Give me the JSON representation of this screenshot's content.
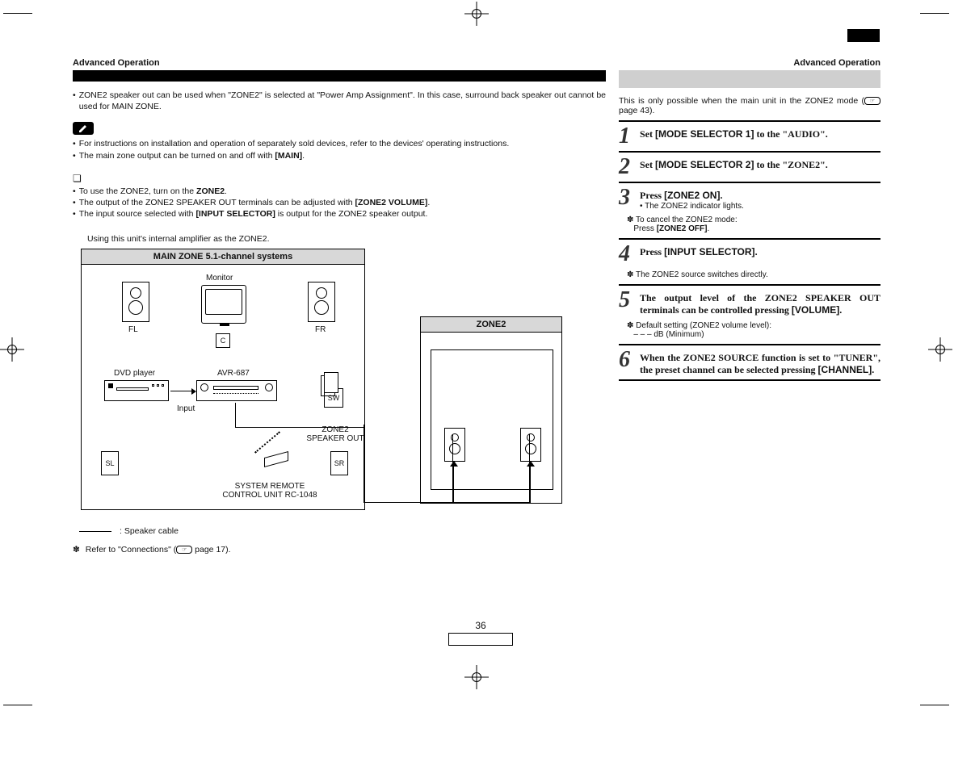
{
  "header_left": "Advanced Operation",
  "header_right": "Advanced Operation",
  "intro1": "ZONE2 speaker out can be used when \"ZONE2\" is selected at \"Power Amp Assignment\". In this case, surround back speaker out cannot be used for MAIN ZONE.",
  "note1": "For instructions on installation and operation of separately sold devices, refer to the devices' operating instructions.",
  "note2_a": "The main zone output can be turned on and off with ",
  "note2_b": "[MAIN]",
  "note2_c": ".",
  "zone2_b1_a": "To use the ZONE2, turn on the ",
  "zone2_b1_b": "ZONE2",
  "zone2_b1_c": ".",
  "zone2_b2_a": "The output of the ZONE2 SPEAKER OUT terminals can be adjusted with ",
  "zone2_b2_b": "[ZONE2 VOLUME]",
  "zone2_b2_c": ".",
  "zone2_b3_a": "The input source selected with ",
  "zone2_b3_b": "[INPUT SELECTOR]",
  "zone2_b3_c": " is output for the ZONE2 speaker output.",
  "caption": "Using this unit's internal amplifier as the ZONE2.",
  "diagram": {
    "mainzone_title": "MAIN ZONE 5.1-channel systems",
    "monitor": "Monitor",
    "fl": "FL",
    "fr": "FR",
    "c": "C",
    "dvd": "DVD player",
    "avr": "AVR-687",
    "input": "Input",
    "sw": "SW",
    "sl": "SL",
    "sr": "SR",
    "zone2_out": "ZONE2 SPEAKER OUT",
    "remote": "SYSTEM REMOTE\nCONTROL UNIT RC-1048",
    "zone2_title": "ZONE2"
  },
  "legend": " :  Speaker cable",
  "footnote": "Refer to \"Connections\" (",
  "footnote2": " page 17).",
  "right_condition_a": "This is only possible when the main unit in the ZONE2 mode (",
  "right_condition_b": " page 43).",
  "steps": {
    "s1": {
      "pre": "Set ",
      "btn": "[MODE SELECTOR 1]",
      "post": " to the \"AUDIO\"."
    },
    "s2": {
      "pre": "Set ",
      "btn": "[MODE SELECTOR 2]",
      "post": " to the \"ZONE2\"."
    },
    "s3": {
      "pre": "Press ",
      "btn": "[ZONE2 ON]",
      "post": ".",
      "note_dot": "The ZONE2 indicator lights.",
      "cancel_a": "To cancel the ZONE2 mode:",
      "cancel_b": "Press ",
      "cancel_btn": "[ZONE2 OFF]",
      "cancel_c": "."
    },
    "s4": {
      "pre": "Press ",
      "btn": "[INPUT SELECTOR]",
      "post": ".",
      "note": "The ZONE2 source switches directly."
    },
    "s5": {
      "text_a": "The output level of the ZONE2 SPEAKER OUT terminals can be controlled pressing ",
      "btn": "[VOLUME]",
      "text_b": ".",
      "note1": "Default setting (ZONE2 volume level):",
      "note2": "– – – dB (Minimum)"
    },
    "s6": {
      "text_a": "When the ZONE2 SOURCE function is set to \"TUNER\", the preset channel can be selected pressing ",
      "btn": "[CHANNEL]",
      "text_b": "."
    }
  },
  "page_number": "36"
}
